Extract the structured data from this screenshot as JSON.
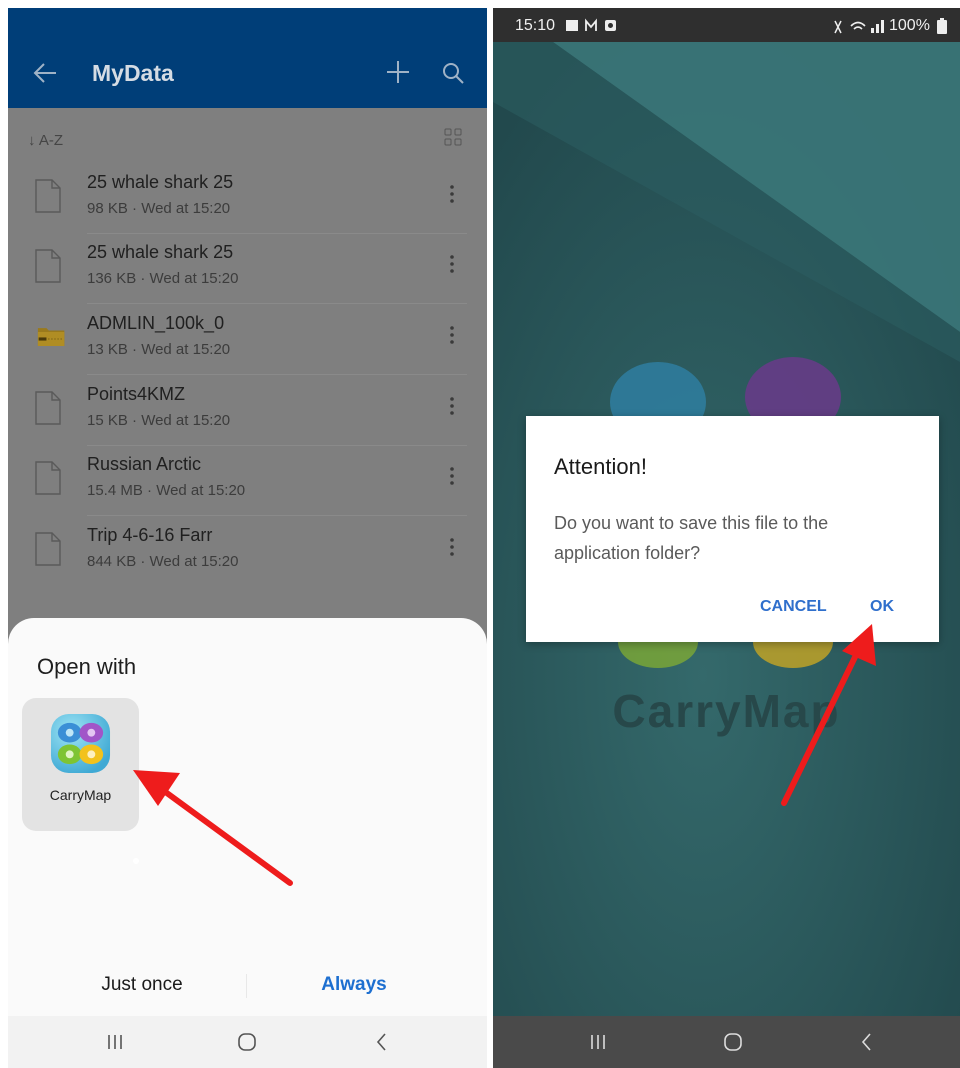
{
  "left": {
    "app_bar": {
      "title": "MyData"
    },
    "sort": {
      "label": "↓ A-Z"
    },
    "files": [
      {
        "name": "25 whale shark 25",
        "meta": "98 KB · Wed at 15:20",
        "icon": "document-icon"
      },
      {
        "name": "25 whale shark 25",
        "meta": "136 KB · Wed at 15:20",
        "icon": "document-icon"
      },
      {
        "name": "ADMLIN_100k_0",
        "meta": "13 KB · Wed at 15:20",
        "icon": "zip-folder-icon"
      },
      {
        "name": "Points4KMZ",
        "meta": "15 KB · Wed at 15:20",
        "icon": "document-icon"
      },
      {
        "name": "Russian Arctic",
        "meta": "15.4 MB · Wed at 15:20",
        "icon": "document-icon"
      },
      {
        "name": "Trip 4-6-16 Farr",
        "meta": "844 KB · Wed at 15:20",
        "icon": "document-icon"
      }
    ],
    "sheet": {
      "title": "Open with",
      "app_name": "CarryMap",
      "just_once": "Just once",
      "always": "Always"
    }
  },
  "right": {
    "status_bar": {
      "time": "15:10",
      "battery": "100%"
    },
    "splash_text": "CarryMap",
    "dialog": {
      "title": "Attention!",
      "message": "Do you want to save this file to the application folder?",
      "cancel": "CANCEL",
      "ok": "OK"
    }
  },
  "colors": {
    "app_bar": "#003e78",
    "accent_blue": "#1d6fd0",
    "annotation_arrow": "#ee1c1c"
  }
}
